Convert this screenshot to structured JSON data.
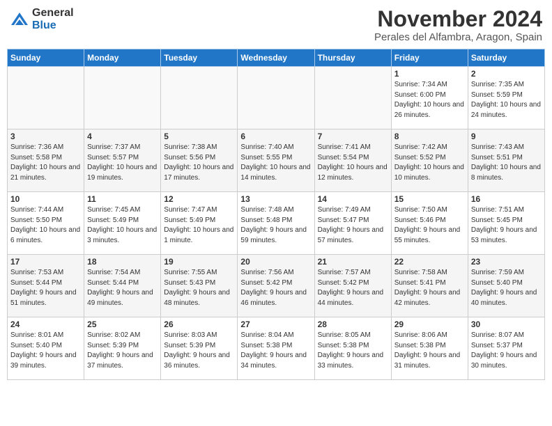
{
  "header": {
    "logo_general": "General",
    "logo_blue": "Blue",
    "month": "November 2024",
    "location": "Perales del Alfambra, Aragon, Spain"
  },
  "days_of_week": [
    "Sunday",
    "Monday",
    "Tuesday",
    "Wednesday",
    "Thursday",
    "Friday",
    "Saturday"
  ],
  "weeks": [
    [
      {
        "day": "",
        "info": ""
      },
      {
        "day": "",
        "info": ""
      },
      {
        "day": "",
        "info": ""
      },
      {
        "day": "",
        "info": ""
      },
      {
        "day": "",
        "info": ""
      },
      {
        "day": "1",
        "info": "Sunrise: 7:34 AM\nSunset: 6:00 PM\nDaylight: 10 hours and 26 minutes."
      },
      {
        "day": "2",
        "info": "Sunrise: 7:35 AM\nSunset: 5:59 PM\nDaylight: 10 hours and 24 minutes."
      }
    ],
    [
      {
        "day": "3",
        "info": "Sunrise: 7:36 AM\nSunset: 5:58 PM\nDaylight: 10 hours and 21 minutes."
      },
      {
        "day": "4",
        "info": "Sunrise: 7:37 AM\nSunset: 5:57 PM\nDaylight: 10 hours and 19 minutes."
      },
      {
        "day": "5",
        "info": "Sunrise: 7:38 AM\nSunset: 5:56 PM\nDaylight: 10 hours and 17 minutes."
      },
      {
        "day": "6",
        "info": "Sunrise: 7:40 AM\nSunset: 5:55 PM\nDaylight: 10 hours and 14 minutes."
      },
      {
        "day": "7",
        "info": "Sunrise: 7:41 AM\nSunset: 5:54 PM\nDaylight: 10 hours and 12 minutes."
      },
      {
        "day": "8",
        "info": "Sunrise: 7:42 AM\nSunset: 5:52 PM\nDaylight: 10 hours and 10 minutes."
      },
      {
        "day": "9",
        "info": "Sunrise: 7:43 AM\nSunset: 5:51 PM\nDaylight: 10 hours and 8 minutes."
      }
    ],
    [
      {
        "day": "10",
        "info": "Sunrise: 7:44 AM\nSunset: 5:50 PM\nDaylight: 10 hours and 6 minutes."
      },
      {
        "day": "11",
        "info": "Sunrise: 7:45 AM\nSunset: 5:49 PM\nDaylight: 10 hours and 3 minutes."
      },
      {
        "day": "12",
        "info": "Sunrise: 7:47 AM\nSunset: 5:49 PM\nDaylight: 10 hours and 1 minute."
      },
      {
        "day": "13",
        "info": "Sunrise: 7:48 AM\nSunset: 5:48 PM\nDaylight: 9 hours and 59 minutes."
      },
      {
        "day": "14",
        "info": "Sunrise: 7:49 AM\nSunset: 5:47 PM\nDaylight: 9 hours and 57 minutes."
      },
      {
        "day": "15",
        "info": "Sunrise: 7:50 AM\nSunset: 5:46 PM\nDaylight: 9 hours and 55 minutes."
      },
      {
        "day": "16",
        "info": "Sunrise: 7:51 AM\nSunset: 5:45 PM\nDaylight: 9 hours and 53 minutes."
      }
    ],
    [
      {
        "day": "17",
        "info": "Sunrise: 7:53 AM\nSunset: 5:44 PM\nDaylight: 9 hours and 51 minutes."
      },
      {
        "day": "18",
        "info": "Sunrise: 7:54 AM\nSunset: 5:44 PM\nDaylight: 9 hours and 49 minutes."
      },
      {
        "day": "19",
        "info": "Sunrise: 7:55 AM\nSunset: 5:43 PM\nDaylight: 9 hours and 48 minutes."
      },
      {
        "day": "20",
        "info": "Sunrise: 7:56 AM\nSunset: 5:42 PM\nDaylight: 9 hours and 46 minutes."
      },
      {
        "day": "21",
        "info": "Sunrise: 7:57 AM\nSunset: 5:42 PM\nDaylight: 9 hours and 44 minutes."
      },
      {
        "day": "22",
        "info": "Sunrise: 7:58 AM\nSunset: 5:41 PM\nDaylight: 9 hours and 42 minutes."
      },
      {
        "day": "23",
        "info": "Sunrise: 7:59 AM\nSunset: 5:40 PM\nDaylight: 9 hours and 40 minutes."
      }
    ],
    [
      {
        "day": "24",
        "info": "Sunrise: 8:01 AM\nSunset: 5:40 PM\nDaylight: 9 hours and 39 minutes."
      },
      {
        "day": "25",
        "info": "Sunrise: 8:02 AM\nSunset: 5:39 PM\nDaylight: 9 hours and 37 minutes."
      },
      {
        "day": "26",
        "info": "Sunrise: 8:03 AM\nSunset: 5:39 PM\nDaylight: 9 hours and 36 minutes."
      },
      {
        "day": "27",
        "info": "Sunrise: 8:04 AM\nSunset: 5:38 PM\nDaylight: 9 hours and 34 minutes."
      },
      {
        "day": "28",
        "info": "Sunrise: 8:05 AM\nSunset: 5:38 PM\nDaylight: 9 hours and 33 minutes."
      },
      {
        "day": "29",
        "info": "Sunrise: 8:06 AM\nSunset: 5:38 PM\nDaylight: 9 hours and 31 minutes."
      },
      {
        "day": "30",
        "info": "Sunrise: 8:07 AM\nSunset: 5:37 PM\nDaylight: 9 hours and 30 minutes."
      }
    ]
  ]
}
